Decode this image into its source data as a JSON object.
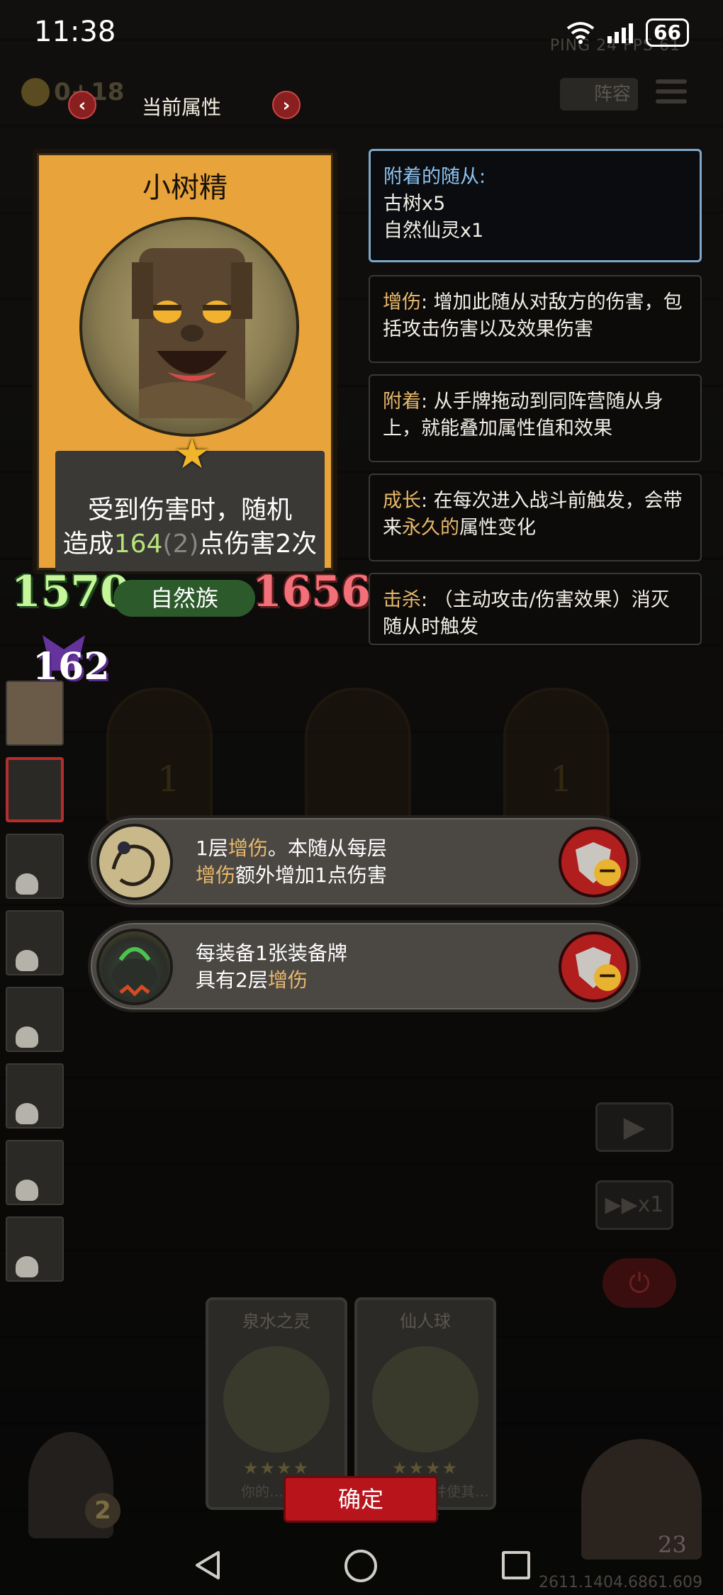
{
  "status_bar": {
    "time": "11:38",
    "battery": "66",
    "ping": "PING 24 FPS 61"
  },
  "top_bar": {
    "gold": "0+18",
    "title": "当前属性",
    "prev_arrow": "‹",
    "next_arrow": "›",
    "lineup_label": "阵容"
  },
  "card": {
    "name": "小树精",
    "star": "★",
    "desc_line1": "受到伤害时，随机",
    "desc_prefix": "造成",
    "desc_damage": "164",
    "desc_bonus": "(2)",
    "desc_suffix": "点伤害2次",
    "attack": "1570",
    "health": "1656",
    "race": "自然族",
    "extra_stat": "162"
  },
  "info_boxes": [
    {
      "title": "附着的随从:",
      "lines": [
        "古树x5",
        "自然仙灵x1"
      ]
    },
    {
      "keyword": "增伤",
      "text": ": 增加此随从对敌方的伤害，包括攻击伤害以及效果伤害"
    },
    {
      "keyword": "附着",
      "text": ": 从手牌拖动到同阵营随从身上，就能叠加属性值和效果"
    },
    {
      "keyword": "成长",
      "text_a": ": 在每次进入战斗前触发，会带来",
      "highlight": "永久的",
      "text_b": "属性变化"
    },
    {
      "keyword": "击杀",
      "text": ": （主动攻击/伤害效果）消灭随从时触发"
    }
  ],
  "effects": [
    {
      "line1_a": "1层",
      "line1_kw": "增伤",
      "line1_b": "。本随从每层",
      "line2_kw": "增伤",
      "line2_b": "额外增加1点伤害",
      "icon": "rope-amulet-icon"
    },
    {
      "line1": "每装备1张装备牌",
      "line2_a": "具有2层",
      "line2_kw": "增伤",
      "icon": "cauldron-icon"
    }
  ],
  "board": {
    "slot_values": [
      "1",
      "1"
    ]
  },
  "hand_cards": [
    {
      "name": "泉水之灵",
      "stars": "★★★★",
      "text": "你的…触…"
    },
    {
      "name": "仙人球",
      "stars": "★★★★",
      "text": "友方造成…并使其…2+2"
    }
  ],
  "buttons": {
    "confirm": "确定",
    "play": "▶",
    "speed": "▶▶x1",
    "power": "⏻"
  },
  "deck_count": "2",
  "hero_hp": "23",
  "player_id": "2611.1404.6861.609",
  "colors": {
    "keyword": "#e8b86a",
    "damage_green": "#b7e37a",
    "attack_green": "#c6f59b",
    "health_red": "#f2707a",
    "confirm_red": "#b8141c"
  }
}
